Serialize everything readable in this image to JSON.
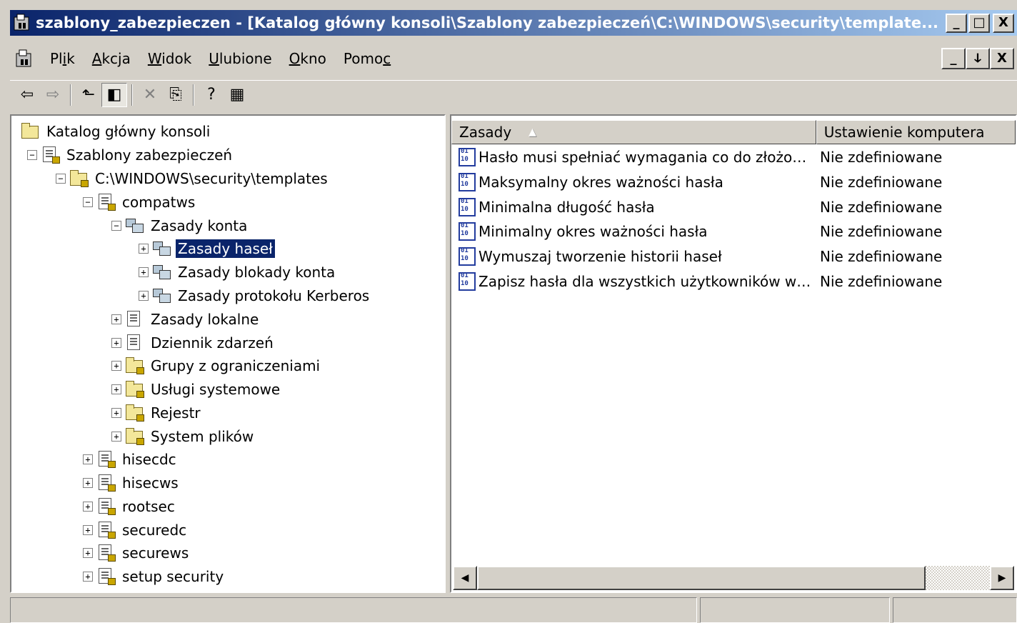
{
  "window": {
    "title": "szablony_zabezpieczen - [Katalog główny konsoli\\Szablony zabezpieczeń\\C:\\WINDOWS\\security\\template...",
    "minimize": "_",
    "maximize": "□",
    "close": "X",
    "restore": "ↆ"
  },
  "menu": {
    "items": [
      {
        "pre": "Pl",
        "ul": "i",
        "post": "k"
      },
      {
        "pre": "",
        "ul": "A",
        "post": "kcja"
      },
      {
        "pre": "",
        "ul": "W",
        "post": "idok"
      },
      {
        "pre": "",
        "ul": "U",
        "post": "lubione"
      },
      {
        "pre": "",
        "ul": "O",
        "post": "kno"
      },
      {
        "pre": "Pomo",
        "ul": "c",
        "post": ""
      }
    ]
  },
  "toolbar": {
    "back": "⇦",
    "forward": "⇨",
    "up": "⬑",
    "show_tree": "◧",
    "delete": "✕",
    "export": "⎘",
    "help": "?",
    "properties": "▦"
  },
  "tree": {
    "items": [
      {
        "label": "Katalog główny konsoli",
        "toggle": ""
      },
      {
        "label": "Szablony zabezpieczeń",
        "toggle": "−"
      },
      {
        "label": "C:\\WINDOWS\\security\\templates",
        "toggle": "−"
      },
      {
        "label": "compatws",
        "toggle": "−"
      },
      {
        "label": "Zasady konta",
        "toggle": "−"
      },
      {
        "label": "Zasady haseł",
        "toggle": "+"
      },
      {
        "label": "Zasady blokady konta",
        "toggle": "+"
      },
      {
        "label": "Zasady protokołu Kerberos",
        "toggle": "+"
      },
      {
        "label": "Zasady lokalne",
        "toggle": "+"
      },
      {
        "label": "Dziennik zdarzeń",
        "toggle": "+"
      },
      {
        "label": "Grupy z ograniczeniami",
        "toggle": "+"
      },
      {
        "label": "Usługi systemowe",
        "toggle": "+"
      },
      {
        "label": "Rejestr",
        "toggle": "+"
      },
      {
        "label": "System plików",
        "toggle": "+"
      },
      {
        "label": "hisecdc",
        "toggle": "+"
      },
      {
        "label": "hisecws",
        "toggle": "+"
      },
      {
        "label": "rootsec",
        "toggle": "+"
      },
      {
        "label": "securedc",
        "toggle": "+"
      },
      {
        "label": "securews",
        "toggle": "+"
      },
      {
        "label": "setup security",
        "toggle": "+"
      }
    ]
  },
  "list": {
    "columns": [
      "Zasady",
      "Ustawienie komputera"
    ],
    "sort_indicator": "▲",
    "rows": [
      {
        "name": "Hasło musi spełniać wymagania co do złożon...",
        "setting": "Nie zdefiniowane"
      },
      {
        "name": "Maksymalny okres ważności hasła",
        "setting": "Nie zdefiniowane"
      },
      {
        "name": "Minimalna długość hasła",
        "setting": "Nie zdefiniowane"
      },
      {
        "name": "Minimalny okres ważności hasła",
        "setting": "Nie zdefiniowane"
      },
      {
        "name": "Wymuszaj tworzenie historii haseł",
        "setting": "Nie zdefiniowane"
      },
      {
        "name": "Zapisz hasła dla wszystkich użytkowników w ...",
        "setting": "Nie zdefiniowane"
      }
    ],
    "scroll_left": "◀",
    "scroll_right": "▶"
  },
  "colors": {
    "title_active": "#0a246a",
    "selection": "#0a246a",
    "face": "#d4d0c8"
  }
}
